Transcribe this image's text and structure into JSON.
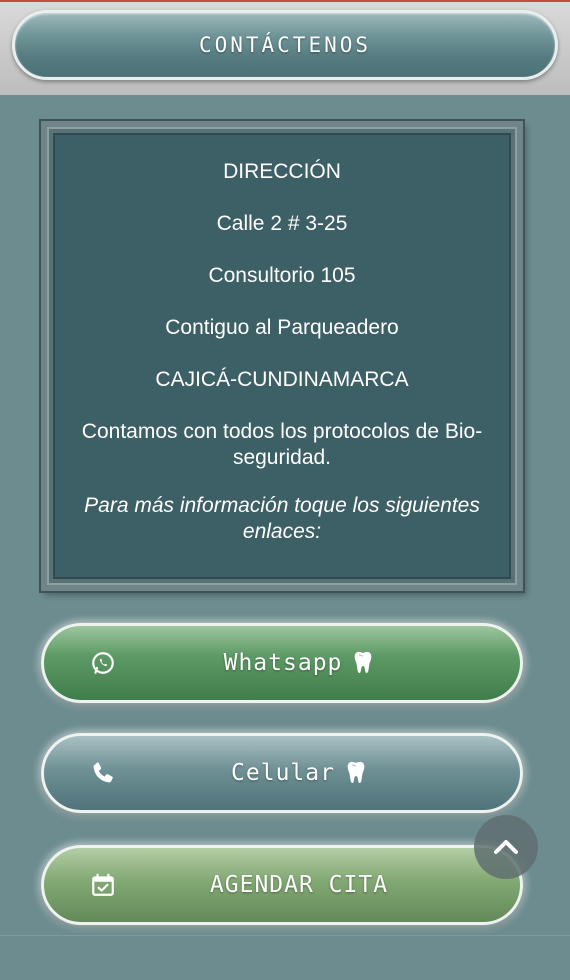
{
  "header": {
    "title": "CONTÁCTENOS"
  },
  "info": {
    "lines": [
      "DIRECCIÓN",
      "Calle 2 # 3-25",
      "Consultorio 105",
      "Contiguo al Parqueadero",
      "CAJICÁ-CUNDINAMARCA",
      "Contamos con todos los protocolos de Bio-seguridad.",
      "Para más información toque los siguientes enlaces:"
    ]
  },
  "buttons": {
    "whatsapp": {
      "label": "Whatsapp",
      "icon": "whatsapp-icon",
      "suffix_icon": "tooth-icon"
    },
    "celular": {
      "label": "Celular",
      "icon": "phone-icon",
      "suffix_icon": "tooth-icon"
    },
    "agendar": {
      "label": "AGENDAR CITA",
      "icon": "calendar-check-icon"
    }
  },
  "scroll_top": {
    "icon": "chevron-up-icon"
  },
  "colors": {
    "whatsapp_button": "#4f8c5a",
    "celular_button": "#5f8388",
    "agendar_button": "#73996a",
    "info_panel": "#3d5f66",
    "page_background": "#6d8c8f"
  }
}
